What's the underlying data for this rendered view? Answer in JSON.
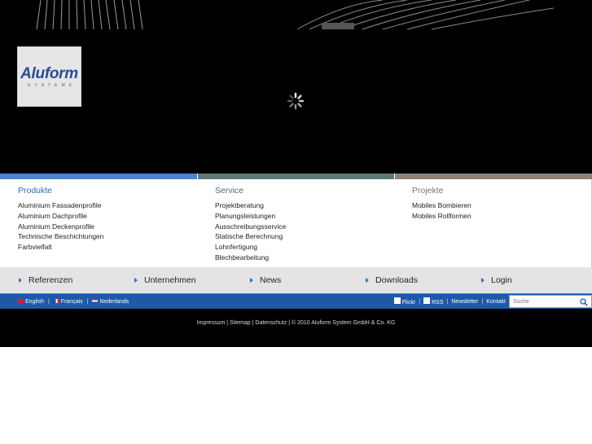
{
  "logo": {
    "word": "Aluform",
    "sub": "SYSTEME"
  },
  "menu": {
    "columns": [
      {
        "title": "Produkte",
        "items": [
          "Aluminium Fassadenprofile",
          "Aluminium Dachprofile",
          "Aluminium Deckenprofile",
          "Technische Beschichtungen",
          "Farbvielfalt"
        ]
      },
      {
        "title": "Service",
        "items": [
          "Projektberatung",
          "Planungsleistungen",
          "Ausschreibungsservice",
          "Statische Berechnung",
          "Lohnfertigung",
          "Blechbearbeitung"
        ]
      },
      {
        "title": "Projekte",
        "items": [
          "Mobiles Bombieren",
          "Mobiles Rollformen"
        ]
      }
    ]
  },
  "nav": {
    "items": [
      "Referenzen",
      "Unternehmen",
      "News",
      "Downloads",
      "Login"
    ]
  },
  "lang_bar": {
    "languages": [
      "English",
      "Français",
      "Nederlands"
    ],
    "links": [
      "Flickr",
      "RSS",
      "Newsletter",
      "Kontakt"
    ],
    "search_placeholder": "Suche"
  },
  "footer": {
    "text": "Impressum | Sitemap | Datenschutz | © 2010 Aluform System GmbH & Co. KG"
  },
  "colors": {
    "produkte": "#2f6fba",
    "service": "#4e6e6c",
    "projekte": "#7d746b",
    "lang_bar": "#1d59a6"
  }
}
